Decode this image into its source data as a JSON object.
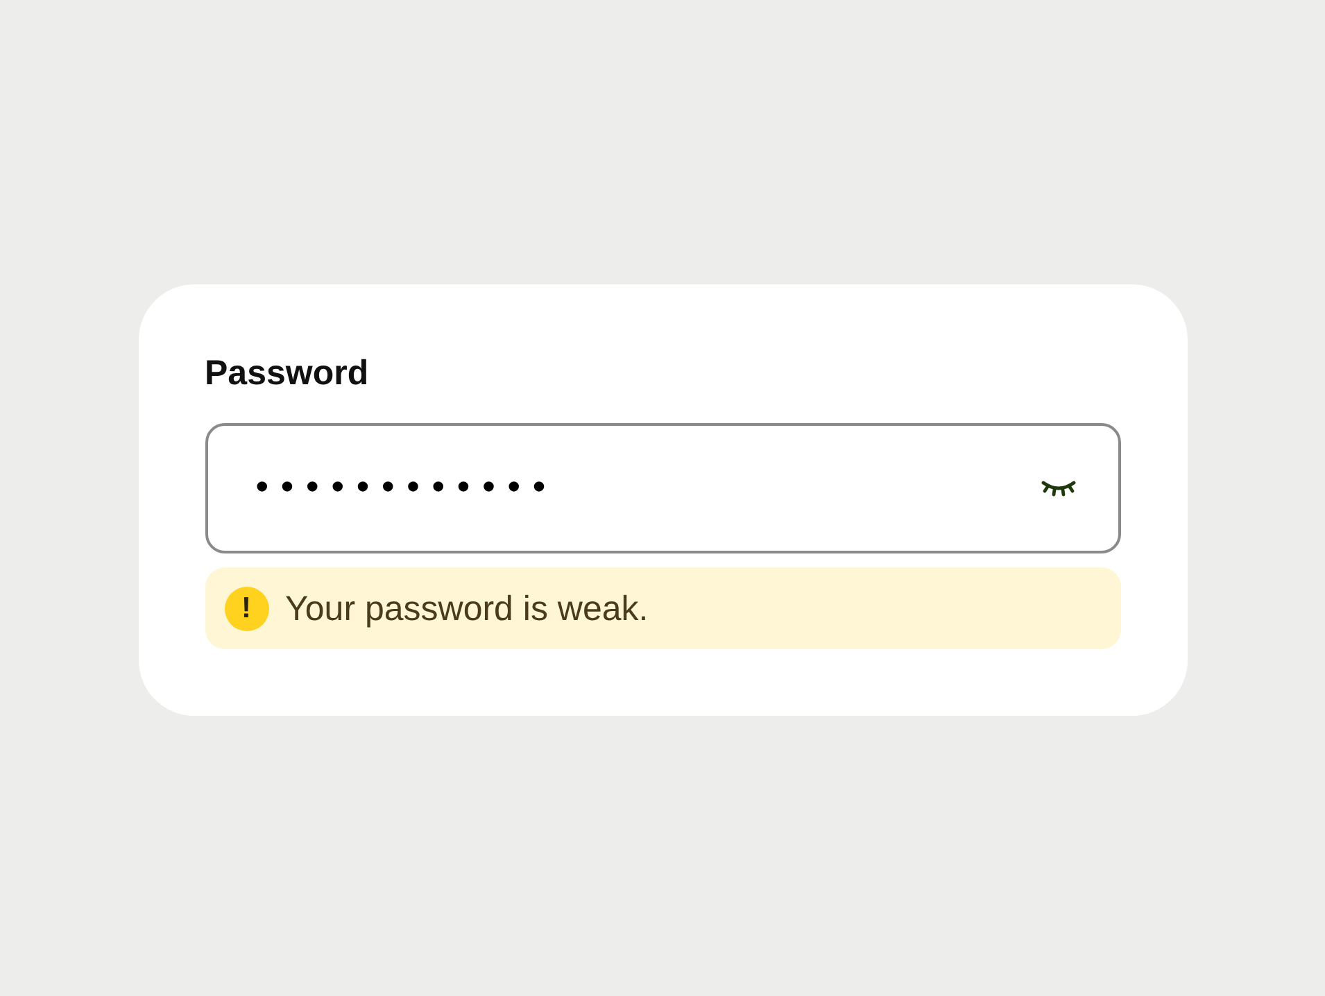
{
  "field": {
    "label": "Password",
    "value": "••••••••••••",
    "visible": false
  },
  "message": {
    "kind": "warning",
    "icon": "!",
    "text": "Your password is weak."
  }
}
